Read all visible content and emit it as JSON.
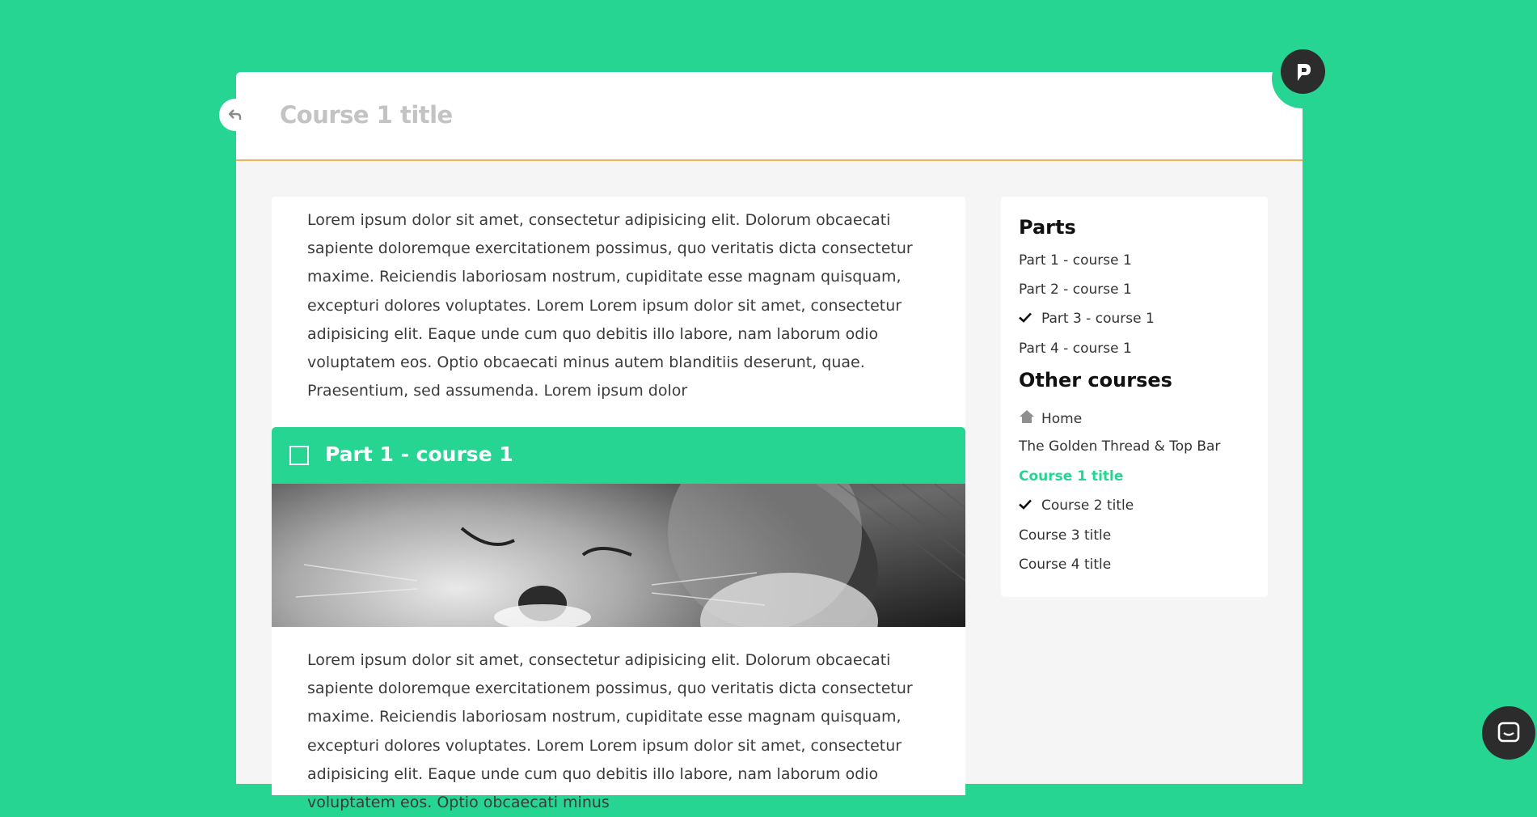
{
  "header": {
    "course_title": "Course 1 title"
  },
  "icons": {
    "back": "back-arrow-icon",
    "logo": "brand-logo-icon",
    "checkbox": "checkbox-icon",
    "check": "checkmark-icon",
    "home": "home-icon",
    "chat": "chat-icon"
  },
  "colors": {
    "background": "#26d592",
    "accent": "#26d592",
    "header_border": "#f1b25a",
    "title_muted": "#c3c3c3"
  },
  "main": {
    "intro_text": "Lorem ipsum dolor sit amet, consectetur adipisicing elit. Dolorum obcaecati sapiente doloremque exercitationem possimus, quo veritatis dicta consectetur maxime. Reiciendis laboriosam nostrum, cupiditate esse magnam quisquam, excepturi dolores voluptates. Lorem Lorem ipsum dolor sit amet, consectetur adipisicing elit. Eaque unde cum quo debitis illo labore, nam laborum odio voluptatem eos. Optio obcaecati minus autem blanditiis deserunt, quae. Praesentium, sed assumenda. Lorem ipsum dolor",
    "part": {
      "title": "Part 1 - course 1",
      "text": "Lorem ipsum dolor sit amet, consectetur adipisicing elit. Dolorum obcaecati sapiente doloremque exercitationem possimus, quo veritatis dicta consectetur maxime. Reiciendis laboriosam nostrum, cupiditate esse magnam quisquam, excepturi dolores voluptates. Lorem Lorem ipsum dolor sit amet, consectetur adipisicing elit. Eaque unde cum quo debitis illo labore, nam laborum odio voluptatem eos. Optio obcaecati minus"
    }
  },
  "sidebar": {
    "parts_heading": "Parts",
    "parts": [
      {
        "label": "Part 1 - course 1",
        "done": false
      },
      {
        "label": "Part 2 - course 1",
        "done": false
      },
      {
        "label": "Part 3 - course 1",
        "done": true
      },
      {
        "label": "Part 4 - course 1",
        "done": false
      }
    ],
    "other_heading": "Other courses",
    "courses": [
      {
        "label": "Home",
        "icon": "home-icon"
      },
      {
        "label": "The Golden Thread & Top Bar"
      },
      {
        "label": "Course 1 title",
        "active": true
      },
      {
        "label": "Course 2 title",
        "done": true
      },
      {
        "label": "Course 3 title"
      },
      {
        "label": "Course 4 title"
      }
    ]
  }
}
